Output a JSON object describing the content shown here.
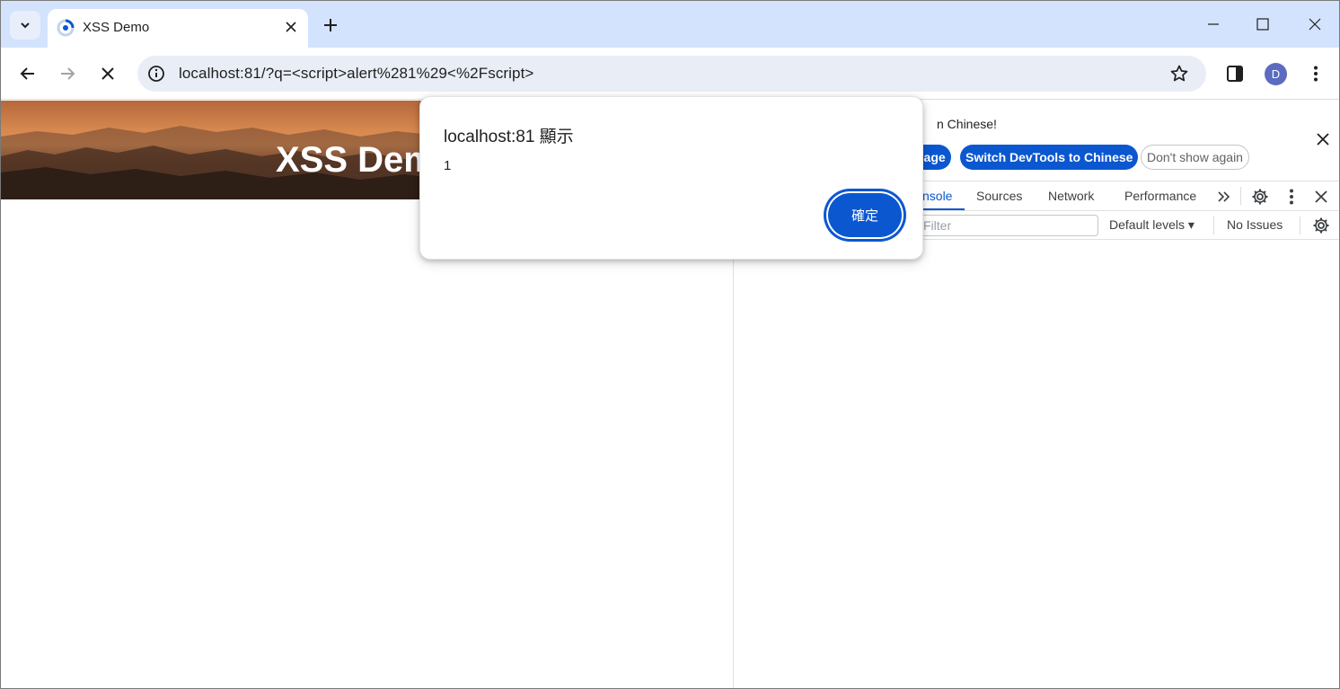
{
  "browser": {
    "tab_title": "XSS Demo",
    "address": "localhost:81/?q=<script>alert%281%29<%2Fscript>",
    "profile_initial": "D"
  },
  "page": {
    "banner_title": "XSS Demo"
  },
  "alert": {
    "title": "localhost:81 顯示",
    "message": "1",
    "ok_label": "確定"
  },
  "devtools": {
    "language_message": "n Chinese!",
    "btn_language": "uage",
    "btn_switch": "Switch DevTools to Chinese",
    "btn_dont_show": "Don't show again",
    "tabs": [
      "nsole",
      "Sources",
      "Network",
      "Performance"
    ],
    "filter_placeholder": "Filter",
    "levels_label": "Default levels ▾",
    "issues_label": "No Issues"
  },
  "colors": {
    "accent": "#0b57d0",
    "tabstrip": "#d3e3fd",
    "omnibox": "#e9eef6",
    "avatar": "#5c6bc0"
  }
}
